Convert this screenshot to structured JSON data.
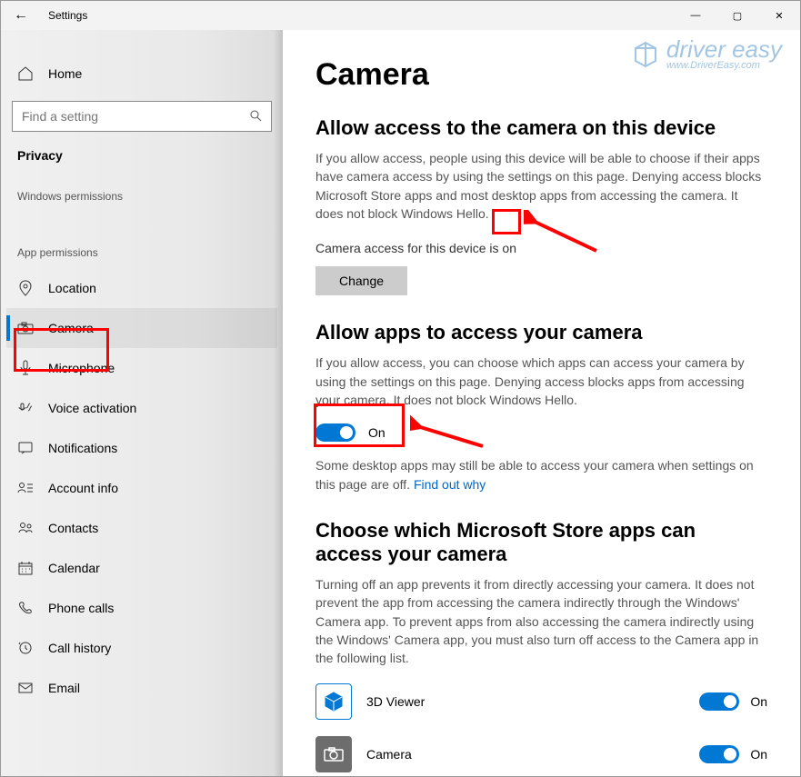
{
  "window": {
    "title": "Settings",
    "minimize": "—",
    "maximize": "▢",
    "close": "✕",
    "back": "←"
  },
  "sidebar": {
    "home": "Home",
    "search_placeholder": "Find a setting",
    "crumb": "Privacy",
    "section_windows": "Windows permissions",
    "section_app": "App permissions",
    "items": [
      {
        "label": "Location"
      },
      {
        "label": "Camera"
      },
      {
        "label": "Microphone"
      },
      {
        "label": "Voice activation"
      },
      {
        "label": "Notifications"
      },
      {
        "label": "Account info"
      },
      {
        "label": "Contacts"
      },
      {
        "label": "Calendar"
      },
      {
        "label": "Phone calls"
      },
      {
        "label": "Call history"
      },
      {
        "label": "Email"
      }
    ]
  },
  "content": {
    "page_title": "Camera",
    "sec1_title": "Allow access to the camera on this device",
    "sec1_body": "If you allow access, people using this device will be able to choose if their apps have camera access by using the settings on this page. Denying access blocks Microsoft Store apps and most desktop apps from accessing the camera. It does not block Windows Hello.",
    "status_prefix": "Camera access for this device is ",
    "status_value": "on",
    "change_label": "Change",
    "sec2_title": "Allow apps to access your camera",
    "sec2_body": "If you allow access, you can choose which apps can access your camera by using the settings on this page. Denying access blocks apps from accessing your camera. It does not block Windows Hello.",
    "toggle_state": "On",
    "sec2_note_a": "Some desktop apps may still be able to access your camera when settings on this page are off. ",
    "sec2_note_link": "Find out why",
    "sec3_title": "Choose which Microsoft Store apps can access your camera",
    "sec3_body": "Turning off an app prevents it from directly accessing your camera. It does not prevent the app from accessing the camera indirectly through the Windows' Camera app. To prevent apps from also accessing the camera indirectly using the Windows' Camera app, you must also turn off access to the Camera app in the following list.",
    "apps": [
      {
        "name": "3D Viewer",
        "state": "On"
      },
      {
        "name": "Camera",
        "state": "On"
      }
    ]
  },
  "watermark": {
    "brand": "driver easy",
    "url": "www.DriverEasy.com"
  }
}
